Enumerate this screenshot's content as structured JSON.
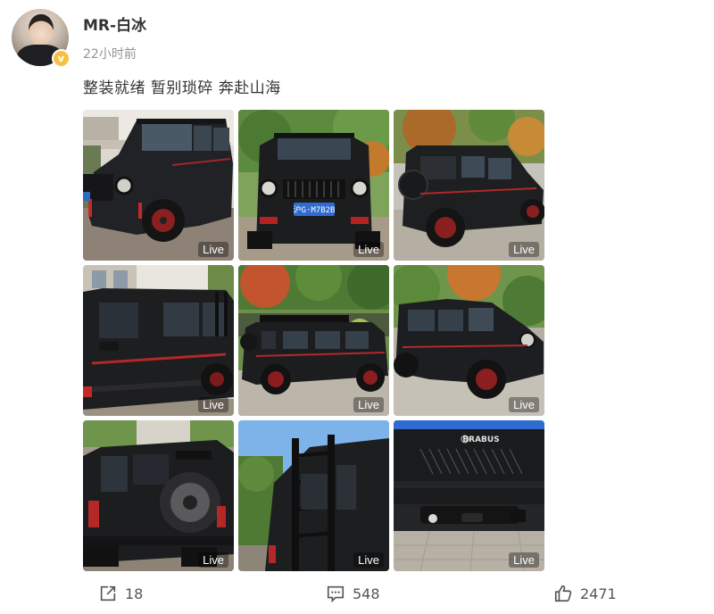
{
  "post": {
    "username": "MR-白冰",
    "timestamp": "22小时前",
    "text": "整装就绪 暂别琐碎 奔赴山海",
    "verified_icon": "verified-badge-icon",
    "verified_color": "#f6c142"
  },
  "photos": [
    {
      "live": "Live"
    },
    {
      "live": "Live",
      "plate": "沪G·M7B2B"
    },
    {
      "live": "Live"
    },
    {
      "live": "Live"
    },
    {
      "live": "Live"
    },
    {
      "live": "Live"
    },
    {
      "live": "Live"
    },
    {
      "live": "Live"
    },
    {
      "live": "Live",
      "brand": "BRABUS"
    }
  ],
  "actions": {
    "repost_count": "18",
    "comment_count": "548",
    "like_count": "2471"
  }
}
